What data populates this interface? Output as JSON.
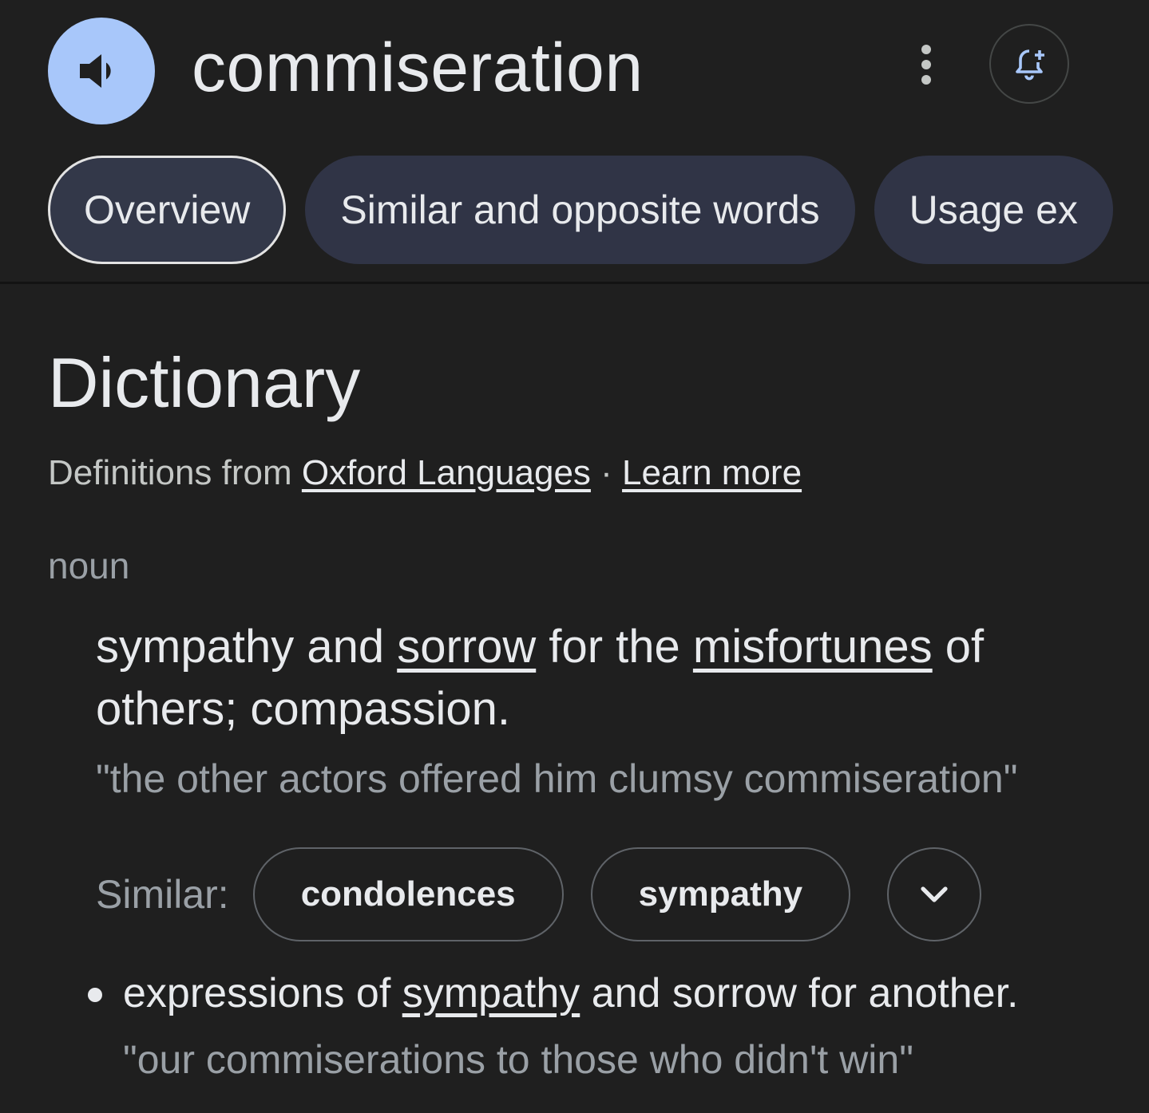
{
  "header": {
    "word": "commiseration",
    "speaker_icon": "volume-icon",
    "more_icon": "more-vert-icon",
    "alert_icon": "add-alert-icon"
  },
  "tabs": [
    {
      "label": "Overview",
      "active": true
    },
    {
      "label": "Similar and opposite words",
      "active": false
    },
    {
      "label": "Usage ex",
      "active": false
    }
  ],
  "dictionary": {
    "title": "Dictionary",
    "source_prefix": "Definitions from ",
    "source_link": "Oxford Languages",
    "separator": " · ",
    "learn_more": "Learn more",
    "part_of_speech": "noun",
    "definition": {
      "part1": "sympathy and ",
      "link1": "sorrow",
      "part2": " for the ",
      "link2": "misfortunes",
      "part3": " of others; compassion."
    },
    "example": "\"the other actors offered him clumsy commiseration\"",
    "similar_label": "Similar:",
    "similar_chips": [
      "condolences",
      "sympathy"
    ],
    "expand_icon": "chevron-down-icon",
    "sub_definition": {
      "part1": "expressions of ",
      "link": "sympathy",
      "part2": " and sorrow for another."
    },
    "sub_example": "\"our commiserations to those who didn't win\""
  },
  "colors": {
    "background": "#1f1f1f",
    "speaker_accent": "#a8c7fa",
    "tab_background": "#303446",
    "text_primary": "#e8eaed",
    "text_secondary": "#9aa0a6"
  }
}
